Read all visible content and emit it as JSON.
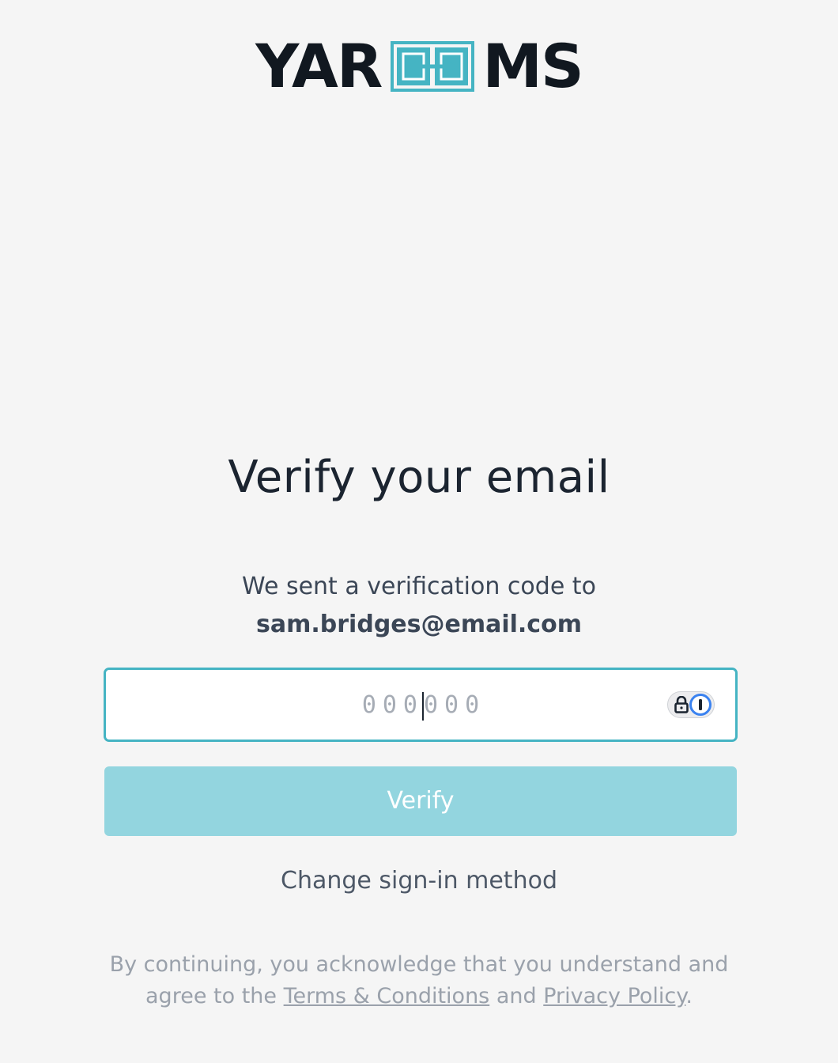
{
  "brand": {
    "logo_left": "YAR",
    "logo_right": "MS",
    "logo_accent_color": "#45b4c3"
  },
  "title": "Verify your email",
  "subtitle": "We sent a verification code to",
  "email": "sam.bridges@email.com",
  "code_input": {
    "placeholder": "000000",
    "value": "",
    "autofill_icon": "password-manager-icon"
  },
  "verify_button": {
    "label": "Verify",
    "color": "#93d5df"
  },
  "change_method_label": "Change sign-in method",
  "legal": {
    "line1": "By continuing, you acknowledge that you understand and",
    "prefix": "agree to the",
    "terms_label": "Terms & Conditions",
    "and_text": "and",
    "privacy_label": "Privacy Policy",
    "suffix": "."
  }
}
